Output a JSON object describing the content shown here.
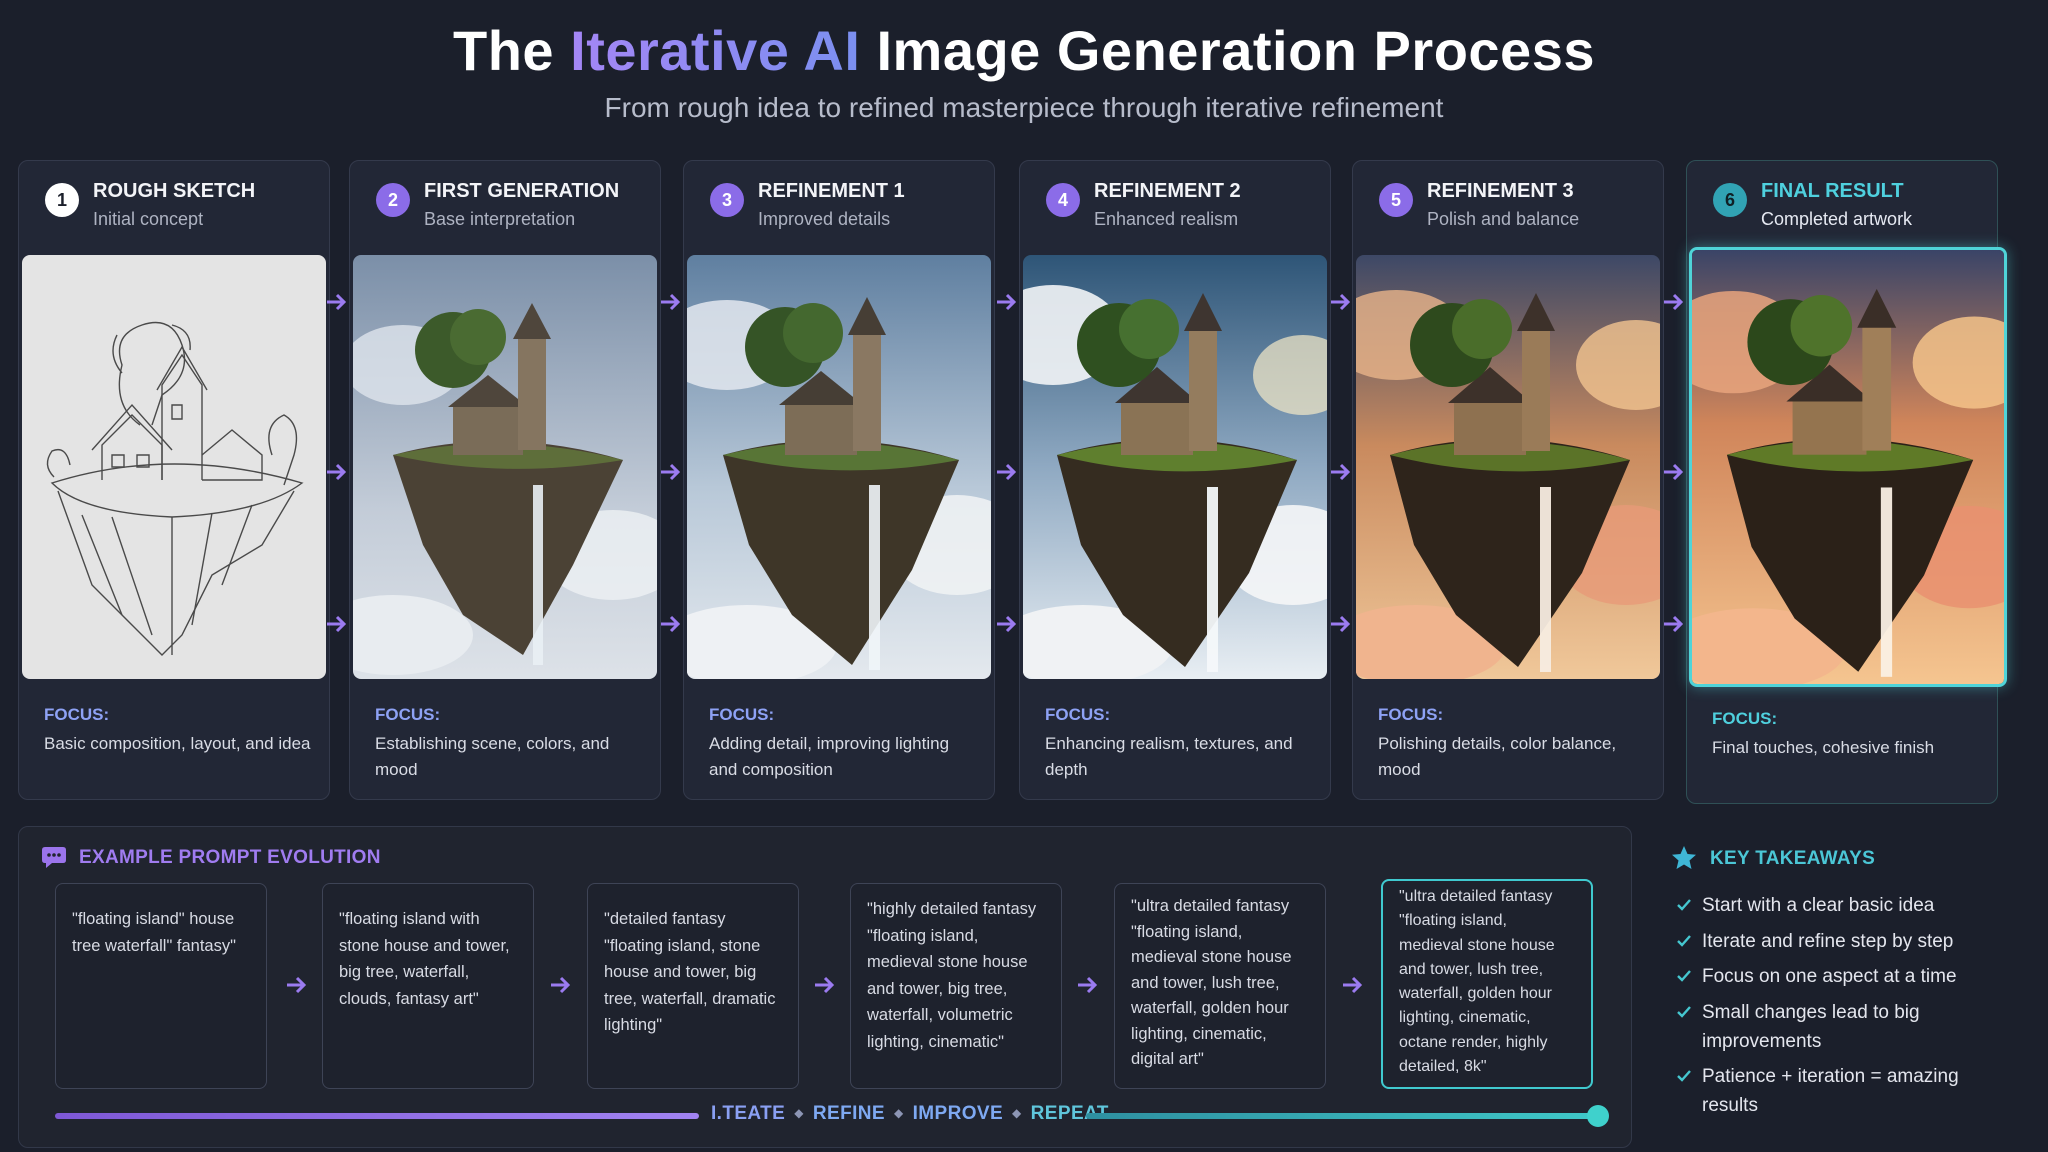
{
  "header": {
    "title_part1": "The",
    "title_accent": "Iterative AI",
    "title_part2": "Image Generation Process",
    "subtitle": "From rough idea to refined masterpiece through iterative refinement"
  },
  "stages": [
    {
      "number": "1",
      "title": "ROUGH SKETCH",
      "subtitle": "Initial concept",
      "focus_label": "FOCUS:",
      "focus_text": "Basic composition, layout, and idea"
    },
    {
      "number": "2",
      "title": "FIRST GENERATION",
      "subtitle": "Base interpretation",
      "focus_label": "FOCUS:",
      "focus_text": "Establishing scene, colors, and mood"
    },
    {
      "number": "3",
      "title": "REFINEMENT 1",
      "subtitle": "Improved details",
      "focus_label": "FOCUS:",
      "focus_text": "Adding detail, improving lighting and composition"
    },
    {
      "number": "4",
      "title": "REFINEMENT 2",
      "subtitle": "Enhanced realism",
      "focus_label": "FOCUS:",
      "focus_text": "Enhancing realism, textures, and depth"
    },
    {
      "number": "5",
      "title": "REFINEMENT 3",
      "subtitle": "Polish and balance",
      "focus_label": "FOCUS:",
      "focus_text": "Polishing details, color balance, mood"
    },
    {
      "number": "6",
      "title": "FINAL RESULT",
      "subtitle": "Completed artwork",
      "focus_label": "FOCUS:",
      "focus_text": "Final touches, cohesive finish"
    }
  ],
  "prompt_evolution": {
    "title": "EXAMPLE PROMPT EVOLUTION",
    "prompts": [
      "\"floating island\" house tree waterfall\" fantasy\"",
      "\"floating island with stone house and tower, big tree, waterfall, clouds, fantasy art\"",
      "\"detailed fantasy \"floating island, stone house and tower, big tree, waterfall, dramatic lighting\"",
      "\"highly detailed fantasy \"floating island, medieval stone house and tower, big tree, waterfall, volumetric lighting, cinematic\"",
      "\"ultra detailed fantasy \"floating island, medieval stone house and tower, lush tree, waterfall, golden hour lighting, cinematic, digital art\"",
      "\"ultra detailed fantasy \"floating island, medieval stone house and tower, lush tree, waterfall, golden hour lighting, cinematic, octane render, highly detailed, 8k\""
    ],
    "iterate_words": [
      "I.TEATE",
      "REFINE",
      "IMPROVE",
      "REPEAT"
    ]
  },
  "key_takeaways": {
    "title": "KEY TAKEAWAYS",
    "items": [
      "Start with a clear basic idea",
      "Iterate and refine step by step",
      "Focus on one aspect at a time",
      "Small changes lead to big improvements",
      "Patience + iteration = amazing results"
    ]
  },
  "colors": {
    "background": "#1b1f2b",
    "accent_purple": "#8b6ce8",
    "accent_teal": "#4fd0de",
    "focus_blue": "#8ea2f5"
  },
  "icons": {
    "stage_arrow": "right-arrow-icon",
    "prompt_panel": "chat-bubble-icon",
    "takeaways": "star-icon",
    "takeaway_item": "check-icon"
  }
}
